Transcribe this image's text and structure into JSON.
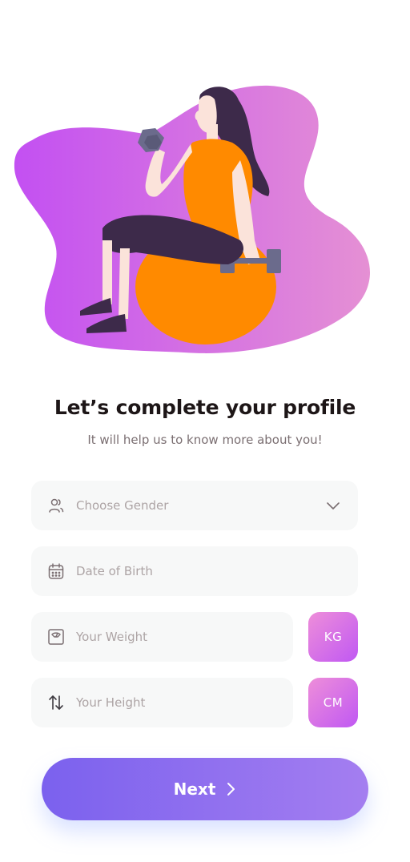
{
  "header": {
    "title": "Let’s complete your profile",
    "subtitle": "It will help us to know more about you!"
  },
  "form": {
    "gender": {
      "placeholder": "Choose Gender",
      "icon": "users-icon"
    },
    "dob": {
      "placeholder": "Date of Birth",
      "icon": "calendar-icon"
    },
    "weight": {
      "placeholder": "Your Weight",
      "icon": "scale-icon",
      "unit": "KG"
    },
    "height": {
      "placeholder": "Your Height",
      "icon": "swap-arrows-icon",
      "unit": "CM"
    }
  },
  "actions": {
    "next_label": "Next"
  },
  "colors": {
    "accent_purple": "#7b61ee",
    "accent_pink": "#ee8ed9",
    "field_bg": "#f7f8f8",
    "orange": "#ff8a00"
  }
}
